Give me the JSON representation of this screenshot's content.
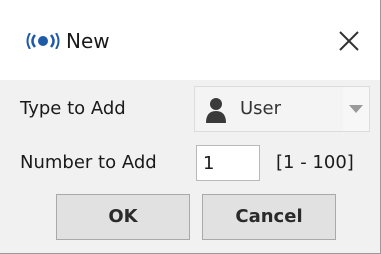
{
  "window": {
    "title": "New",
    "app_icon": "app-logo-icon",
    "close_icon": "close-icon"
  },
  "form": {
    "type_label": "Type to Add",
    "type_value": "User",
    "type_icon": "user-icon",
    "number_label": "Number to Add",
    "number_value": "1",
    "number_range": "[1 - 100]"
  },
  "buttons": {
    "ok": "OK",
    "cancel": "Cancel"
  },
  "colors": {
    "accent": "#1f5aa8",
    "body_bg": "#f1f1f1"
  }
}
